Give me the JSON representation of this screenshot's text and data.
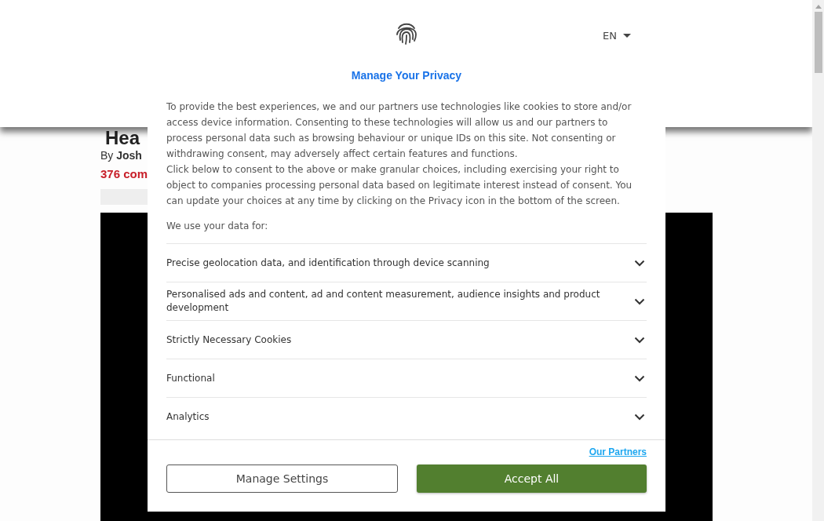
{
  "article": {
    "heading": "Hea",
    "byline_prefix": "By",
    "author": "Josh",
    "comments": "376 com"
  },
  "dialog": {
    "language": "EN",
    "title": "Manage Your Privacy",
    "intro": [
      "To provide the best experiences, we and our partners use technologies like cookies to store and/or access device information. Consenting to these technologies will allow us and our partners to process personal data such as browsing behaviour or unique IDs on this site. Not consenting or withdrawing consent, may adversely affect certain features and functions.",
      "Click below to consent to the above or make granular choices, including exercising your right to object to companies processing personal data based on legitimate interest instead of consent. You can update your choices at any time by clicking on the Privacy icon in the bottom of the screen."
    ],
    "purposes_heading": "We use your data for:",
    "purposes": [
      {
        "label": "Precise geolocation data, and identification through device scanning",
        "expanded": false
      },
      {
        "label": "Personalised ads and content, ad and content measurement, audience insights and product development",
        "expanded": false
      },
      {
        "label": "Strictly Necessary Cookies",
        "expanded": false
      },
      {
        "label": "Functional",
        "expanded": false
      },
      {
        "label": "Analytics",
        "expanded": false
      }
    ],
    "partners_link": "Our Partners",
    "buttons": [
      {
        "label": "Manage Settings",
        "kind": "secondary"
      },
      {
        "label": "Accept All",
        "kind": "primary"
      }
    ]
  }
}
